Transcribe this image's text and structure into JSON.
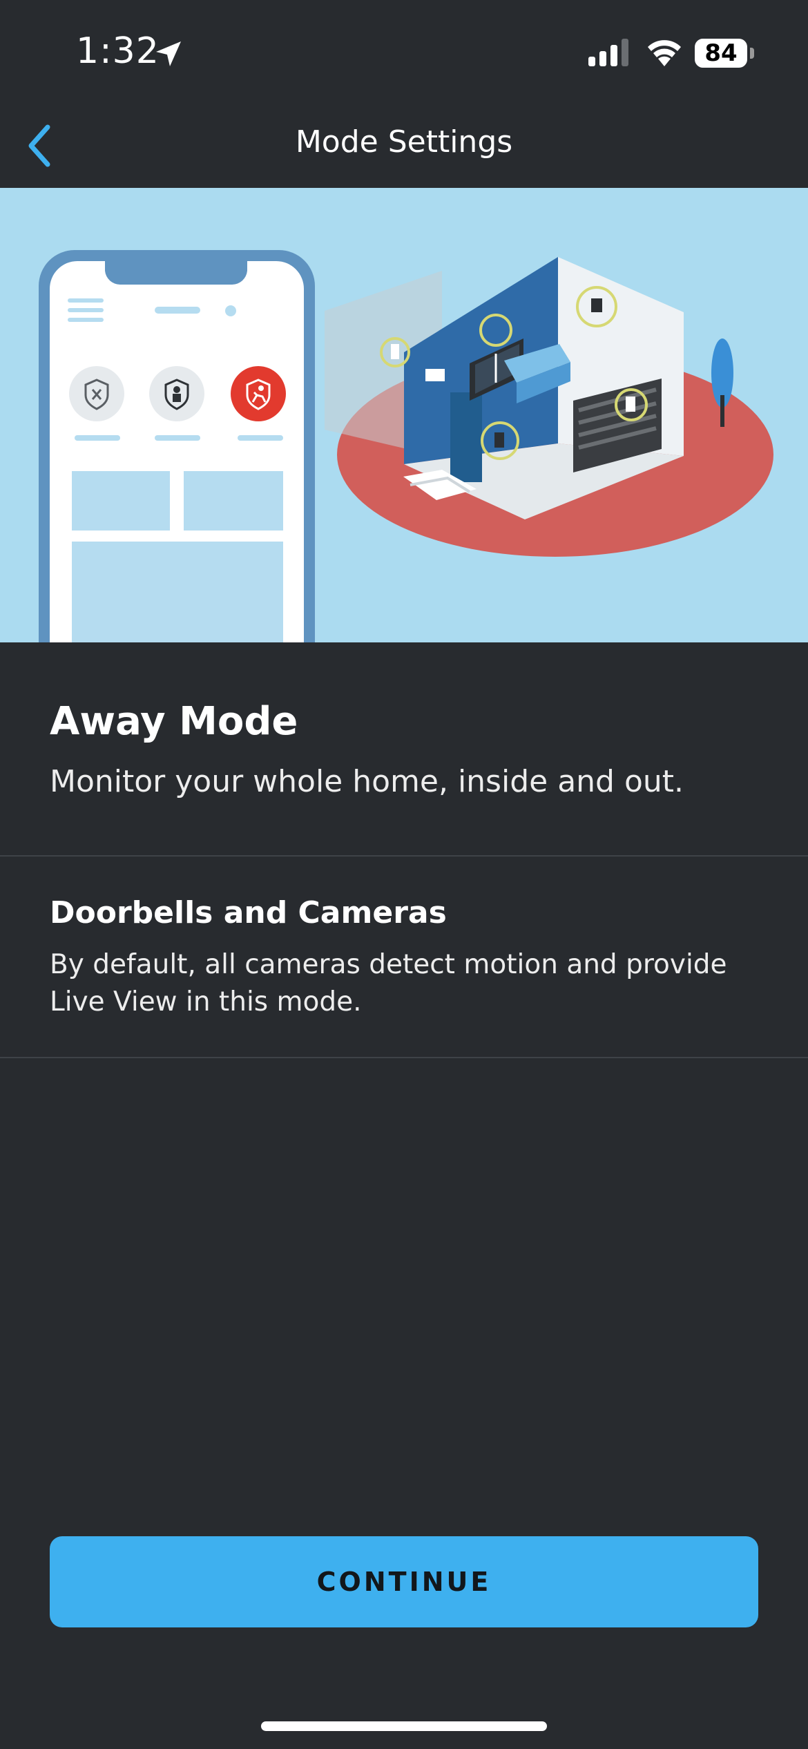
{
  "status_bar": {
    "time": "1:32",
    "battery": "84",
    "icons": [
      "location-arrow-icon",
      "cellular-signal-icon",
      "wifi-icon",
      "battery-icon"
    ]
  },
  "nav": {
    "title": "Mode Settings",
    "back_icon": "chevron-left-icon",
    "accent_color": "#3eb0ef"
  },
  "hero": {
    "illustration": "phone-and-house-illustration",
    "mode_icons": [
      "disarmed-shield-icon",
      "home-shield-icon",
      "away-running-icon"
    ],
    "active_mode_color": "#e23a2e"
  },
  "mode": {
    "title": "Away Mode",
    "description": "Monitor your whole home, inside and out."
  },
  "cameras": {
    "title": "Doorbells and Cameras",
    "description": "By default, all cameras detect motion and provide Live View in this mode."
  },
  "continue_button": {
    "label": "CONTINUE",
    "color": "#3eb0ef"
  }
}
